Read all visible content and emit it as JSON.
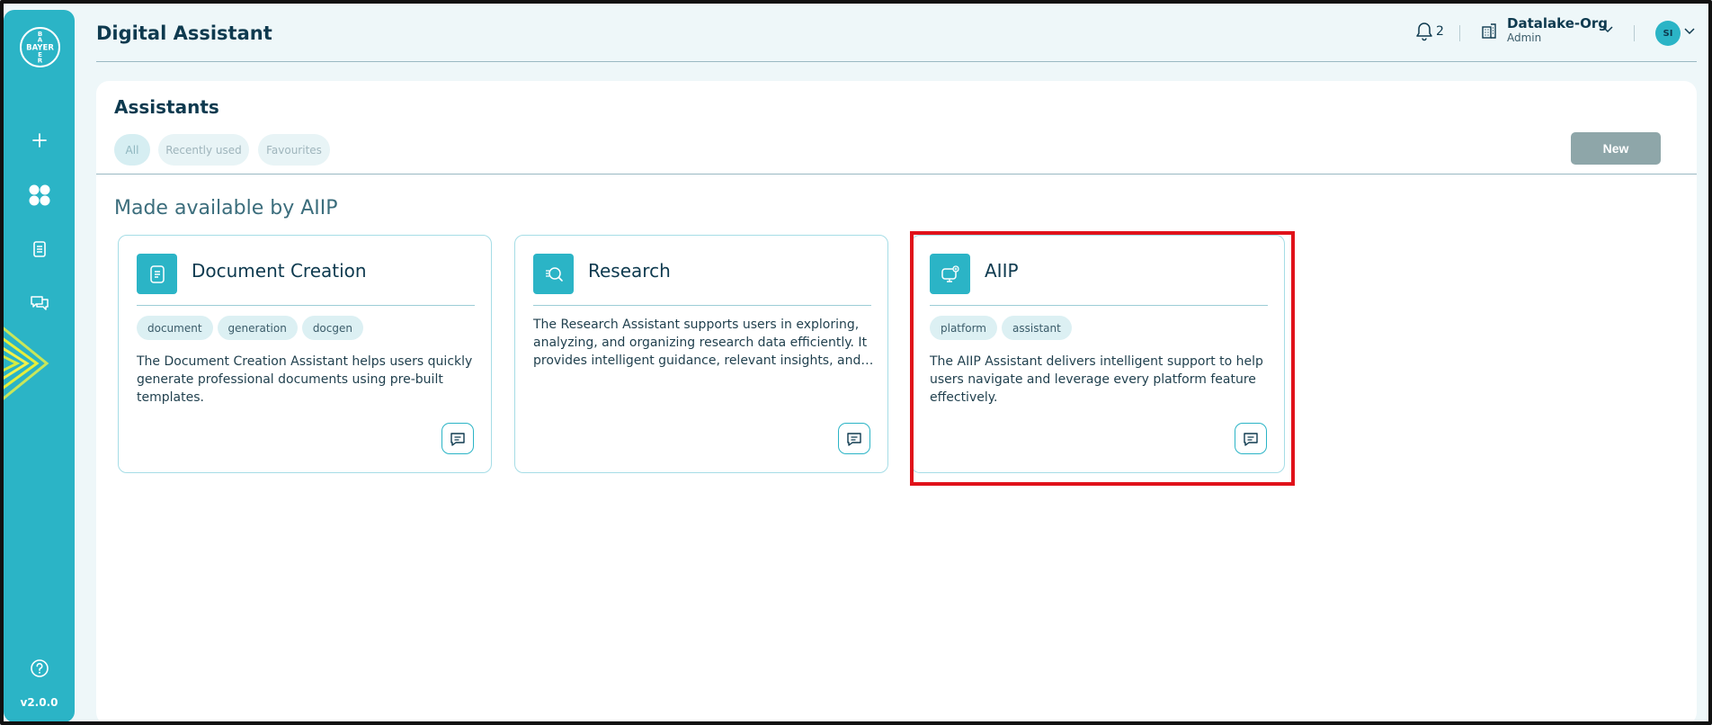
{
  "app": {
    "title": "Digital Assistant",
    "version": "v2.0.0",
    "logo_text": "BAYER"
  },
  "header": {
    "notifications_count": "2",
    "org_name": "Datalake-Org",
    "org_role": "Admin",
    "avatar_initials": "SI"
  },
  "page": {
    "title": "Assistants",
    "filters": [
      "All",
      "Recently used",
      "Favourites"
    ],
    "new_label": "New",
    "section_title": "Made available by AIIP"
  },
  "cards": [
    {
      "title": "Document Creation",
      "tags": [
        "document",
        "generation",
        "docgen"
      ],
      "description": "The Document Creation Assistant helps users quickly generate professional documents using pre-built templates."
    },
    {
      "title": "Research",
      "tags": [],
      "description": "The Research Assistant supports users in exploring, analyzing, and organizing research data efficiently. It provides intelligent guidance, relevant insights, and tools to streamline research workflows."
    },
    {
      "title": "AIIP",
      "tags": [
        "platform",
        "assistant"
      ],
      "description": "The AIIP Assistant delivers intelligent support to help users navigate and leverage every platform feature effectively."
    }
  ],
  "colors": {
    "accent": "#2bb4c6",
    "highlight": "#e0121a",
    "new_button": "#8ea6a9"
  }
}
